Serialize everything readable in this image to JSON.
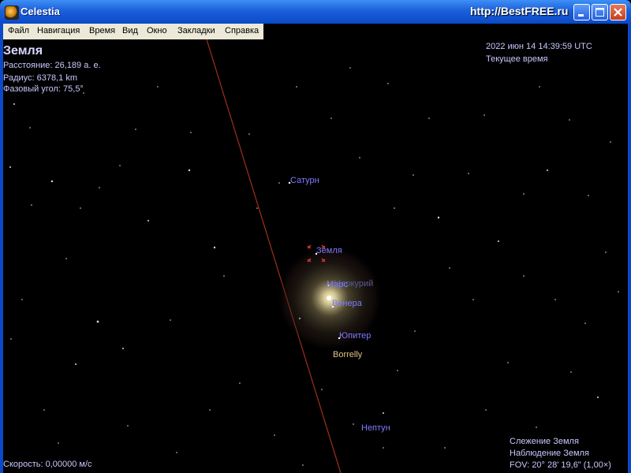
{
  "window": {
    "title": "Celestia",
    "watermark": "http://BestFREE.ru"
  },
  "menu": [
    "Файл",
    "Навигация",
    "Время",
    "Вид",
    "Окно",
    "Закладки",
    "Справка"
  ],
  "hud": {
    "object_name": "Земля",
    "distance": "Расстояние: 26,189 а. е.",
    "radius": "Радиус: 6378,1 km",
    "phase": "Фазовый угол: 75,5°",
    "datetime": "2022 июн 14 14:39:59 UTC",
    "time_mode": "Текущее время",
    "speed": "Скорость: 0,00000 м/с",
    "tracking": "Слежение Земля",
    "observing": "Наблюдение Земля",
    "fov": "FOV: 20° 28' 19,6\" (1,00×)"
  },
  "labels": {
    "saturn": "Сатурн",
    "earth": "Земля",
    "mercury": "Меркурий",
    "mars": "Марс",
    "venus": "Венера",
    "jupiter": "Юпитер",
    "borrelly": "Borrelly",
    "neptune": "Нептун"
  },
  "colors": {
    "label_planet": "#7b7bff",
    "label_comet": "#e0c48a",
    "orbit_line": "#a0301e",
    "hud_text": "#c8c8ff"
  }
}
